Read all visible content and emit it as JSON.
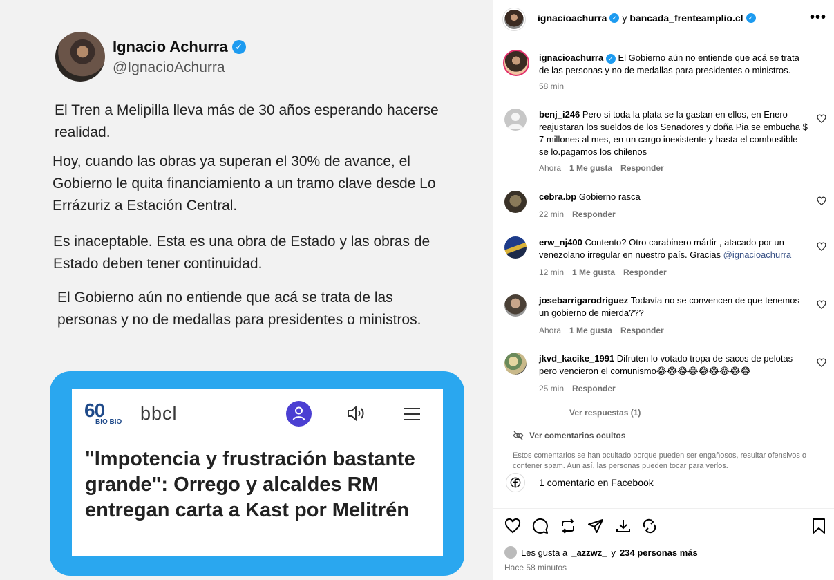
{
  "tweet": {
    "name": "Ignacio Achurra",
    "handle": "@IgnacioAchurra",
    "p1": "El Tren a Melipilla lleva más de 30 años esperando hacerse realidad.",
    "p2": "Hoy, cuando las obras ya superan el 30% de avance, el Gobierno le quita financiamiento a un tramo clave desde Lo Errázuriz a Estación Central.",
    "p3": "Es inaceptable. Esta es una obra de Estado y las obras de Estado deben tener continuidad.",
    "p4": "El Gobierno aún no entiende que acá se trata de las personas y no de medallas para presidentes o ministros.",
    "news_logo_num": "60",
    "news_logo_sub": "BIO BIO",
    "news_brand": "bbcl",
    "headline": "\"Impotencia y frustración bastante grande\": Orrego y alcaldes RM entregan carta a Kast por Melitrén"
  },
  "post": {
    "author": "ignacioachurra",
    "connector": "y",
    "coauthor": "bancada_frenteamplio.cl",
    "more": "•••",
    "caption_user": "ignacioachurra",
    "caption": "El Gobierno aún no entiende que acá se trata de las personas y no de medallas para presidentes o ministros.",
    "caption_time": "58 min"
  },
  "comments": [
    {
      "user": "benj_i246",
      "text": "Pero si toda la plata se la gastan en ellos, en Enero reajustaran los sueldos de los Senadores y doña Pia se embucha $ 7 millones al mes, en un cargo inexistente y hasta el combustible se lo.pagamos los chilenos",
      "time": "Ahora",
      "likes": "1 Me gusta",
      "reply": "Responder"
    },
    {
      "user": "cebra.bp",
      "text": "Gobierno rasca",
      "time": "22 min",
      "likes": "",
      "reply": "Responder"
    },
    {
      "user": "erw_nj400",
      "text": "Contento? Otro carabinero mártir , atacado por un venezolano irregular en nuestro país. Gracias ",
      "mention": "@ignacioachurra",
      "time": "12 min",
      "likes": "1 Me gusta",
      "reply": "Responder"
    },
    {
      "user": "josebarrigarodriguez",
      "text": "Todavía no se convencen de que tenemos un gobierno de mierda???",
      "time": "Ahora",
      "likes": "1 Me gusta",
      "reply": "Responder"
    },
    {
      "user": "jkvd_kacike_1991",
      "text": "Difruten lo votado tropa de sacos de pelotas pero vencieron el comunismo😂😂😂😂😂😂😂😂😂",
      "time": "25 min",
      "likes": "",
      "reply": "Responder"
    }
  ],
  "view_replies": "Ver respuestas (1)",
  "hidden_link": "Ver comentarios ocultos",
  "hidden_note": "Estos comentarios se han ocultado porque pueden ser engañosos, resultar ofensivos o contener spam. Aun así, las personas pueden tocar para verlos.",
  "facebook": "1 comentario en Facebook",
  "likes_text": "Les gusta a",
  "likes_user": "_azzwz_",
  "likes_and": "y",
  "likes_count": "234 personas más",
  "posted_ago": "Hace 58 minutos"
}
